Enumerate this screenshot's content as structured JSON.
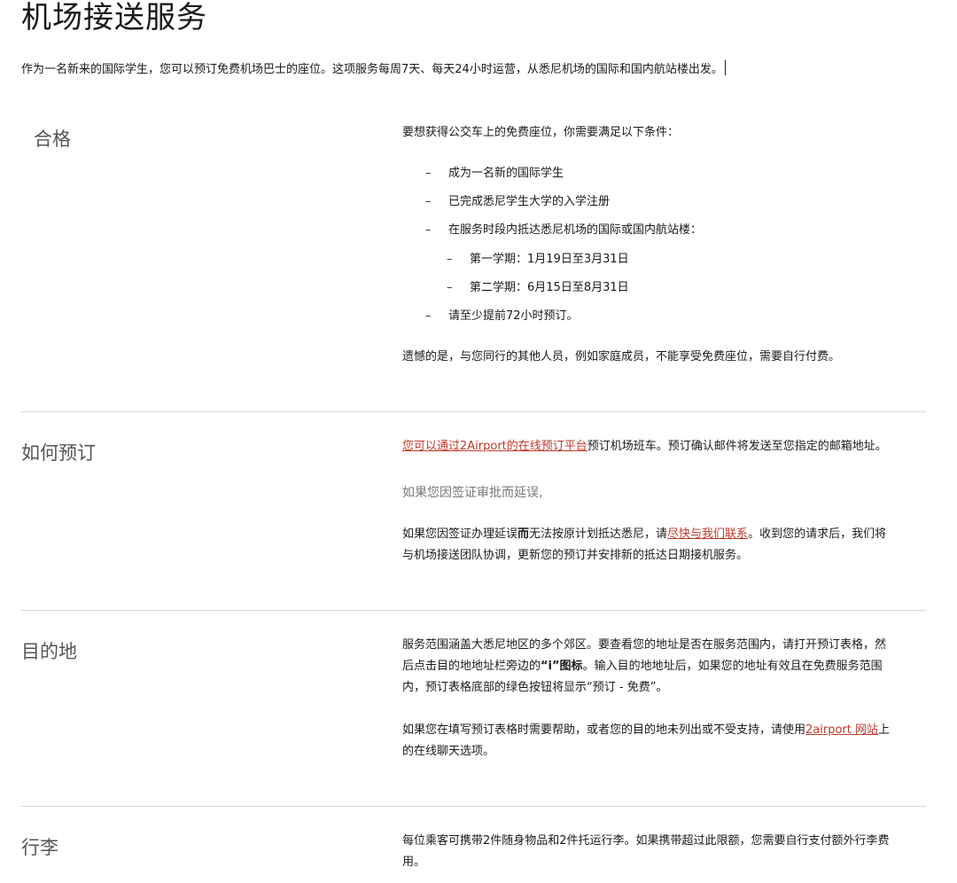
{
  "page": {
    "title": "机场接送服务",
    "intro": "作为一名新来的国际学生，您可以预订免费机场巴士的座位。这项服务每周7天、每天24小时运营，从悉尼机场的国际和国内航站楼出发。"
  },
  "eligibility": {
    "heading": "合格",
    "lead": "要想获得公交车上的免费座位，你需要满足以下条件：",
    "items": [
      "成为一名新的国际学生",
      "已完成悉尼学生大学的入学注册",
      "在服务时段内抵达悉尼机场的国际或国内航站楼："
    ],
    "subitems": [
      "第一学期：1月19日至3月31日",
      "第二学期：6月15日至8月31日"
    ],
    "last_item": "请至少提前72小时预订。",
    "note": "遗憾的是，与您同行的其他人员，例如家庭成员，不能享受免费座位，需要自行付费。"
  },
  "booking": {
    "heading": "如何预订",
    "link_text": "您可以通过2Airport的在线预订平台",
    "text_after_link": "预订机场班车。预订确认邮件将发送至您指定的邮箱地址。",
    "muted_line": "如果您因签证审批而延误,",
    "delay_text_1": "如果您因签证办理延误",
    "delay_bold": "而",
    "delay_text_2": "无法按原计划抵达悉尼，请",
    "contact_link": "尽快与我们联系",
    "delay_text_3": "。收到您的请求后，我们将",
    "delay_line_2": "与机场接送团队协调，更新您的预订并安排新的抵达日期接机服务。"
  },
  "destination": {
    "heading": "目的地",
    "line_1": "服务范围涵盖大悉尼地区的多个郊区。要查看您的地址是否在服务范围内，请打开预订表格，然",
    "line_2_a": "后点击目的地地址栏旁边的",
    "line_2_bold": "“i”图标",
    "line_2_b": "。输入目的地地址后，如果您的地址有效且在免费服务范围",
    "line_3": "内，预订表格底部的绿色按钮将显示“预订 - 免费”。",
    "help_a": "如果您在填写预订表格时需要帮助，或者您的目的地未列出或不受支持，请使用",
    "help_link": "2airport 网站",
    "help_b": "上",
    "help_line_2": "的在线聊天选项。"
  },
  "luggage": {
    "heading": "行李",
    "line_1": "每位乘客可携带2件随身物品和2件托运行李。如果携带超过此限额，您需要自行支付额外行李费",
    "line_2": "用。"
  },
  "colors": {
    "link": "#c0392b",
    "divider": "#d8d8d8",
    "muted": "#777777"
  }
}
